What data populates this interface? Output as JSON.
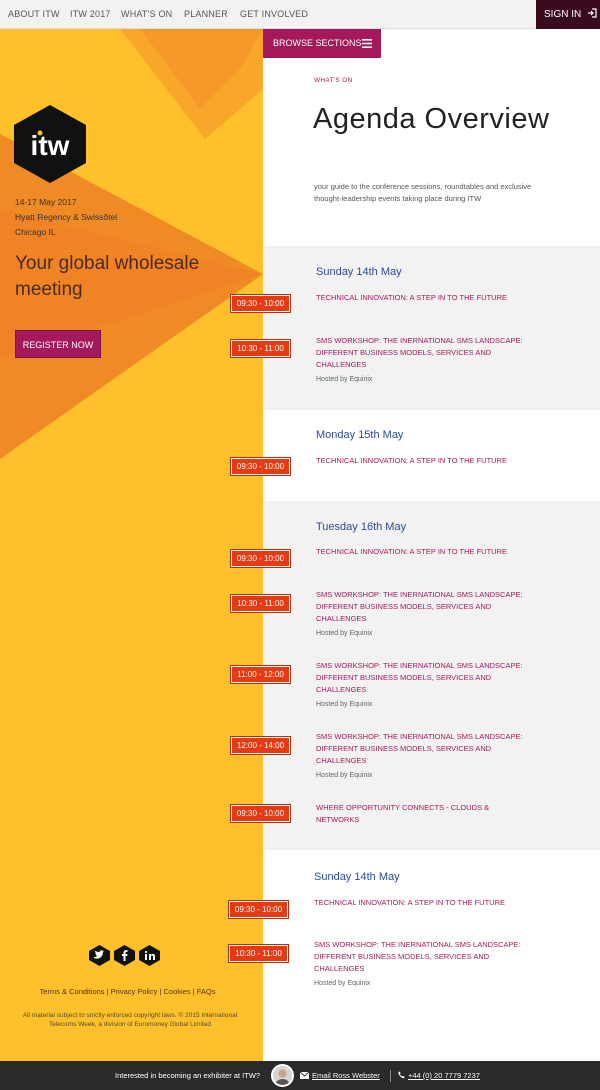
{
  "nav": {
    "items": [
      "ABOUT ITW",
      "ITW 2017",
      "WHAT'S ON",
      "PLANNER",
      "GET INVOLVED"
    ],
    "signin_label": "SIGN IN"
  },
  "browse_label": "BROWSE SECTIONS",
  "event": {
    "logo_text": "itw",
    "date": "14-17 May 2017",
    "venue": "Hyatt Regency & Swissôtel",
    "city": "Chicago IL",
    "tagline": "Your global wholesale meeting",
    "register_label": "REGISTER NOW"
  },
  "header": {
    "eyebrow": "WHAT'S ON",
    "title": "Agenda Overview",
    "intro": "your guide to the conference sessions, roundtables and exclusive thought-leadership events taking place during ITW"
  },
  "days": [
    {
      "title": "Sunday 14th May",
      "sessions": [
        {
          "time": "09:30 - 10:00",
          "title": "TECHNICAL INNOVATION: A STEP IN TO THE FUTURE",
          "hosted": ""
        },
        {
          "time": "10:30 - 11:00",
          "title": "SMS WORKSHOP: THE INERNATIONAL SMS LANDSCAPE: DIFFERENT BUSINESS MODELS, SERVICES AND CHALLENGES",
          "hosted": "Hosted by Equinix"
        }
      ]
    },
    {
      "title": "Monday 15th May",
      "sessions": [
        {
          "time": "09:30 - 10:00",
          "title": "TECHNICAL INNOVATION: A STEP IN TO THE FUTURE",
          "hosted": ""
        }
      ]
    },
    {
      "title": "Tuesday 16th May",
      "sessions": [
        {
          "time": "09:30 - 10:00",
          "title": "TECHNICAL INNOVATION: A STEP IN TO THE FUTURE",
          "hosted": ""
        },
        {
          "time": "10:30 - 11:00",
          "title": "SMS WORKSHOP: THE INERNATIONAL SMS LANDSCAPE: DIFFERENT BUSINESS MODELS, SERVICES AND CHALLENGES",
          "hosted": "Hosted by Equinix"
        },
        {
          "time": "11:00 - 12:00",
          "title": "SMS WORKSHOP: THE INERNATIONAL SMS LANDSCAPE: DIFFERENT BUSINESS MODELS, SERVICES AND CHALLENGES",
          "hosted": "Hosted by Equinix"
        },
        {
          "time": "12:00 - 14:00",
          "title": "SMS WORKSHOP: THE INERNATIONAL SMS LANDSCAPE: DIFFERENT BUSINESS MODELS, SERVICES AND CHALLENGES",
          "hosted": "Hosted by Equinix"
        },
        {
          "time": "09:30 - 10:00",
          "title": "WHERE OPPORTUNITY CONNECTS - CLOUDS & NETWORKS",
          "hosted": ""
        }
      ]
    },
    {
      "title": "Sunday 14th May",
      "sessions": [
        {
          "time": "09:30 - 10:00",
          "title": "TECHNICAL INNOVATION: A STEP IN TO THE FUTURE",
          "hosted": ""
        },
        {
          "time": "10:30 - 11:00",
          "title": "SMS WORKSHOP: THE INERNATIONAL SMS LANDSCAPE: DIFFERENT BUSINESS MODELS, SERVICES AND CHALLENGES",
          "hosted": "Hosted by Equinix"
        }
      ]
    }
  ],
  "social": [
    "twitter-icon",
    "facebook-icon",
    "linkedin-icon"
  ],
  "footer": {
    "links": [
      "Terms & Conditions",
      "Privacy Policy",
      "Cookies",
      "FAQs"
    ],
    "copyright": "All material subject to strictly enforced copyright laws. © 2015 International Telecoms Week, a division of Euromoney Global Limited"
  },
  "bottombar": {
    "text": "Interested in becoming an exhibiter at ITW?",
    "email_label": "Email Ross Webster",
    "phone_label": "+44 (0) 20 7779 7237"
  },
  "colors": {
    "accent": "#a3195b",
    "yellow": "#ffc12b",
    "orange": "#f07c22",
    "time_badge": "#e63a12",
    "day_title": "#2a4b9c"
  }
}
